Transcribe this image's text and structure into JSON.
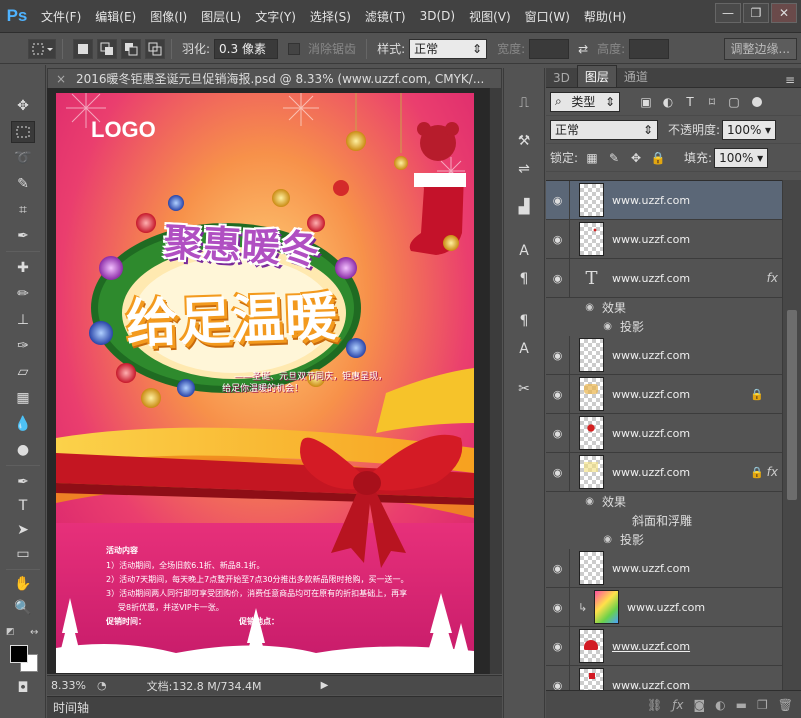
{
  "app": {
    "logo": "Ps"
  },
  "menu": [
    "文件(F)",
    "编辑(E)",
    "图像(I)",
    "图层(L)",
    "文字(Y)",
    "选择(S)",
    "滤镜(T)",
    "3D(D)",
    "视图(V)",
    "窗口(W)",
    "帮助(H)"
  ],
  "window_controls": {
    "minimize": "—",
    "restore": "❐",
    "close": "✕"
  },
  "options": {
    "feather_label": "羽化:",
    "feather_value": "0.3 像素",
    "antialias_label": "消除锯齿",
    "style_label": "样式:",
    "style_value": "正常",
    "width_label": "宽度:",
    "height_label": "高度:",
    "refine_button": "调整边缘..."
  },
  "document": {
    "tab_title": "2016暖冬钜惠圣诞元旦促销海报.psd @ 8.33% (www.uzzf.com, CMYK/...",
    "close": "×",
    "zoom": "8.33%",
    "doc_info": "文档:132.8 M/734.4M"
  },
  "timeline": {
    "label": "时间轴"
  },
  "poster": {
    "logo": "LOGO",
    "title_line1": "聚惠暖冬",
    "title_line2": "给足温暖",
    "slogan_line1": "——圣诞、元旦双节同庆，钜惠呈现，",
    "slogan_line2": "给足你温暖的机会！",
    "activity_title": "活动内容",
    "activity_items": [
      "1）活动期间，全场旧款6.1折、新品8.1折。",
      "2）活动7天期间，每天晚上7点整开始至7点30分推出多款新品限时抢购，买一送一。",
      "3）活动期间两人同行即可享受团购价，消费任意商品均可在原有的折扣基础上，再享",
      "受8折优惠，并送VIP卡一张。"
    ],
    "time_label": "促销时间：",
    "place_label": "促销地点："
  },
  "panel": {
    "tabs": [
      "3D",
      "图层",
      "通道"
    ],
    "active_tab": "图层",
    "menu_icon": "≡",
    "filter_kind": "类型",
    "blend_mode": "正常",
    "opacity_label": "不透明度:",
    "opacity_value": "100%",
    "lock_label": "锁定:",
    "fill_label": "填充:",
    "fill_value": "100%"
  },
  "layers": [
    {
      "name": "www.uzzf.com",
      "type": "raster",
      "selected": true
    },
    {
      "name": "www.uzzf.com",
      "type": "raster",
      "thumb": "red-dots"
    },
    {
      "name": "www.uzzf.com",
      "type": "text",
      "fx": "fx",
      "effects_label": "效果",
      "effects": [
        "投影"
      ]
    },
    {
      "name": "www.uzzf.com",
      "type": "raster"
    },
    {
      "name": "www.uzzf.com",
      "type": "raster",
      "thumb": "gold",
      "lock": "🔒"
    },
    {
      "name": "www.uzzf.com",
      "type": "raster",
      "thumb": "red-cluster"
    },
    {
      "name": "www.uzzf.com",
      "type": "raster",
      "thumb": "yellow",
      "lock": "🔒",
      "fx": "fx",
      "effects_label": "效果",
      "effects": [
        "斜面和浮雕",
        "投影"
      ]
    },
    {
      "name": "www.uzzf.com",
      "type": "raster"
    },
    {
      "name": "www.uzzf.com",
      "type": "clipped",
      "thumb": "colorful"
    },
    {
      "name": "www.uzzf.com",
      "type": "raster",
      "thumb": "red-hat",
      "underline": true
    },
    {
      "name": "www.uzzf.com",
      "type": "raster",
      "thumb": "red-small"
    }
  ],
  "colors": {
    "accent": "#4fb3ff",
    "selected_layer": "#5b6777",
    "poster_pink": "#e42d77",
    "poster_orange": "#f7b64a"
  }
}
